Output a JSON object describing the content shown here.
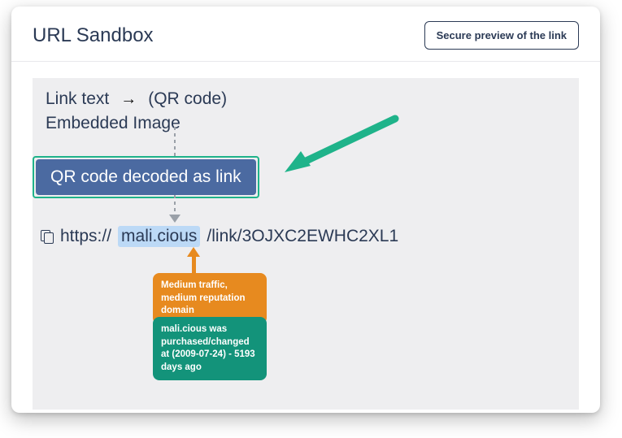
{
  "header": {
    "title": "URL Sandbox",
    "preview_button": "Secure preview of the link"
  },
  "flow": {
    "link_text_label": "Link text",
    "qr_code_label": "(QR code)",
    "embedded_image_label": "Embedded Image",
    "qr_badge": "QR code decoded as link"
  },
  "url": {
    "scheme": "https://",
    "domain": "mali.cious",
    "path": "/link/3OJXC2EWHC2XL1"
  },
  "annotations": {
    "traffic": "Medium traffic, medium reputation domain",
    "purchase": "mali.cious was purchased/changed at (2009-07-24) - 5193 days ago"
  }
}
